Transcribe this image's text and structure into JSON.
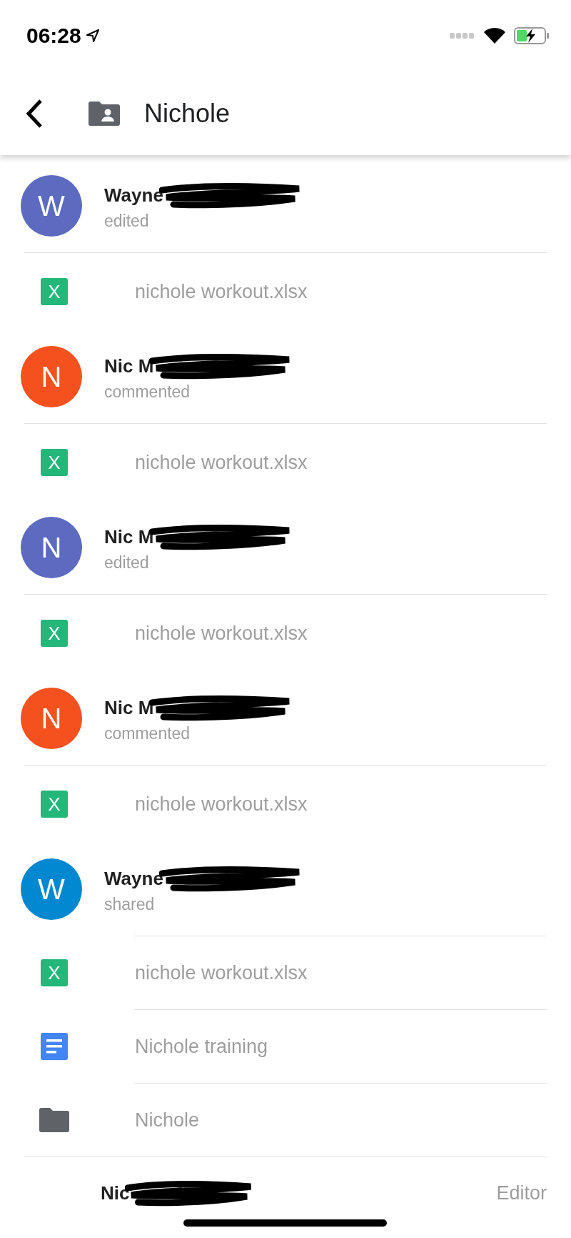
{
  "status_bar": {
    "time": "06:28"
  },
  "header": {
    "title": "Nichole"
  },
  "activity": [
    {
      "avatar_letter": "W",
      "color": "#5c6bc0",
      "name": "Wayne",
      "action": "edited",
      "files": [
        {
          "kind": "sheet",
          "icon_letter": "X",
          "name": "nichole workout.xlsx"
        }
      ]
    },
    {
      "avatar_letter": "N",
      "color": "#f4511e",
      "name": "Nic M",
      "action": "commented",
      "files": [
        {
          "kind": "sheet",
          "icon_letter": "X",
          "name": "nichole workout.xlsx"
        }
      ]
    },
    {
      "avatar_letter": "N",
      "color": "#5c6bc0",
      "name": "Nic M",
      "action": "edited",
      "files": [
        {
          "kind": "sheet",
          "icon_letter": "X",
          "name": "nichole workout.xlsx"
        }
      ]
    },
    {
      "avatar_letter": "N",
      "color": "#f4511e",
      "name": "Nic M",
      "action": "commented",
      "files": [
        {
          "kind": "sheet",
          "icon_letter": "X",
          "name": "nichole workout.xlsx"
        }
      ]
    },
    {
      "avatar_letter": "W",
      "color": "#0288d1",
      "name": "Wayne",
      "action": "shared",
      "files": [
        {
          "kind": "sheet",
          "icon_letter": "X",
          "name": "nichole workout.xlsx"
        },
        {
          "kind": "doc",
          "name": "Nichole training"
        },
        {
          "kind": "folder",
          "name": "Nichole"
        }
      ]
    }
  ],
  "member": {
    "name": "Nic",
    "role": "Editor"
  }
}
